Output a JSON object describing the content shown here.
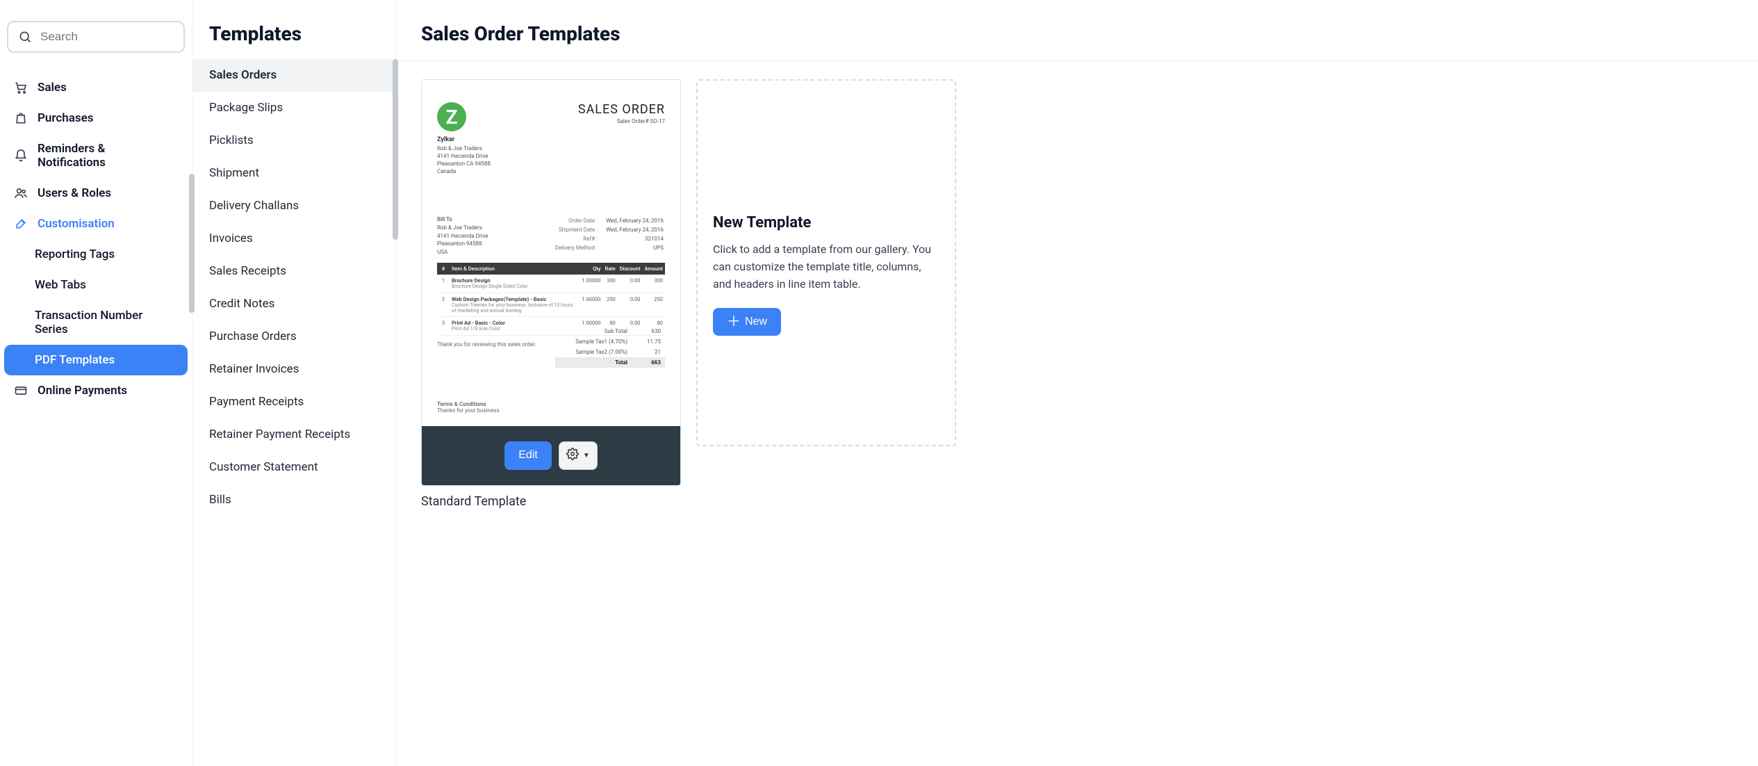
{
  "search": {
    "placeholder": "Search"
  },
  "sidebar": {
    "items": [
      {
        "label": "Sales",
        "icon": "cart-icon",
        "expandable": true
      },
      {
        "label": "Purchases",
        "icon": "bag-icon",
        "expandable": true
      },
      {
        "label": "Reminders & Notifications",
        "icon": "bell-icon",
        "expandable": true
      },
      {
        "label": "Users & Roles",
        "icon": "users-icon",
        "expandable": true
      },
      {
        "label": "Customisation",
        "icon": "brush-icon",
        "expandable": true,
        "active": true,
        "children": [
          {
            "label": "Reporting Tags"
          },
          {
            "label": "Web Tabs"
          },
          {
            "label": "Transaction Number Series"
          },
          {
            "label": "PDF Templates",
            "selected": true
          }
        ]
      },
      {
        "label": "Online Payments",
        "icon": "card-icon",
        "expandable": true
      }
    ]
  },
  "templates": {
    "title": "Templates",
    "items": [
      "Sales Orders",
      "Package Slips",
      "Picklists",
      "Shipment",
      "Delivery Challans",
      "Invoices",
      "Sales Receipts",
      "Credit Notes",
      "Purchase Orders",
      "Retainer Invoices",
      "Payment Receipts",
      "Retainer Payment Receipts",
      "Customer Statement",
      "Bills"
    ],
    "active_index": 0
  },
  "page": {
    "title": "Sales Order Templates",
    "card": {
      "label_below": "Standard Template",
      "edit_label": "Edit",
      "preview": {
        "logo_letter": "Z",
        "doc_title": "SALES ORDER",
        "doc_number": "Sales Order# SO-17",
        "company": {
          "name": "Zylkar",
          "line1": "Rob & Joe Traders",
          "line2": "4141 Hacienda Drive",
          "line3": "Pleasanton CA 94588",
          "line4": "Canada"
        },
        "bill_to_title": "Bill To",
        "bill_to": [
          "Rob & Joe Traders",
          "4141 Hacienda Drive",
          "Pleasanton 94588",
          "USA"
        ],
        "meta": [
          {
            "k": "Order Date :",
            "v": "Wed, February 24, 2016"
          },
          {
            "k": "Shipment Date :",
            "v": "Wed, February 24, 2016"
          },
          {
            "k": "Ref# :",
            "v": "321014"
          },
          {
            "k": "Delivery Method :",
            "v": "UPS"
          }
        ],
        "columns": [
          "#",
          "Item & Description",
          "Qty",
          "Rate",
          "Discount",
          "Amount"
        ],
        "rows": [
          {
            "n": "1",
            "name": "Brochure Design",
            "desc": "Brochure Design Single Sided Color",
            "qty": "1.00000",
            "rate": "300",
            "disc": "0.00",
            "amt": "300"
          },
          {
            "n": "2",
            "name": "Web Design Packages(Template) - Basic",
            "desc": "Custom Themes for your business. Inclusive of 10 hours of marketing and annual training",
            "qty": "1.00000",
            "rate": "250",
            "disc": "0.00",
            "amt": "250"
          },
          {
            "n": "3",
            "name": "Print Ad - Basic - Color",
            "desc": "Print Ad 1/8 size Color",
            "qty": "1.00000",
            "rate": "80",
            "disc": "0.00",
            "amt": "80"
          }
        ],
        "thanks": "Thank you for reviewing this sales order.",
        "totals": [
          {
            "k": "Sub Total",
            "v": "630"
          },
          {
            "k": "Sample Tax1 (4.70%)",
            "v": "11.75"
          },
          {
            "k": "Sample Tax2 (7.00%)",
            "v": "21"
          }
        ],
        "grand_total": {
          "k": "Total",
          "v": "663"
        },
        "terms_title": "Terms & Conditions",
        "terms_body": "Thanks for your business"
      }
    },
    "new_panel": {
      "title": "New Template",
      "body": "Click to add a template from our gallery. You can customize the template title, columns, and headers in line item table.",
      "button": "New"
    }
  }
}
